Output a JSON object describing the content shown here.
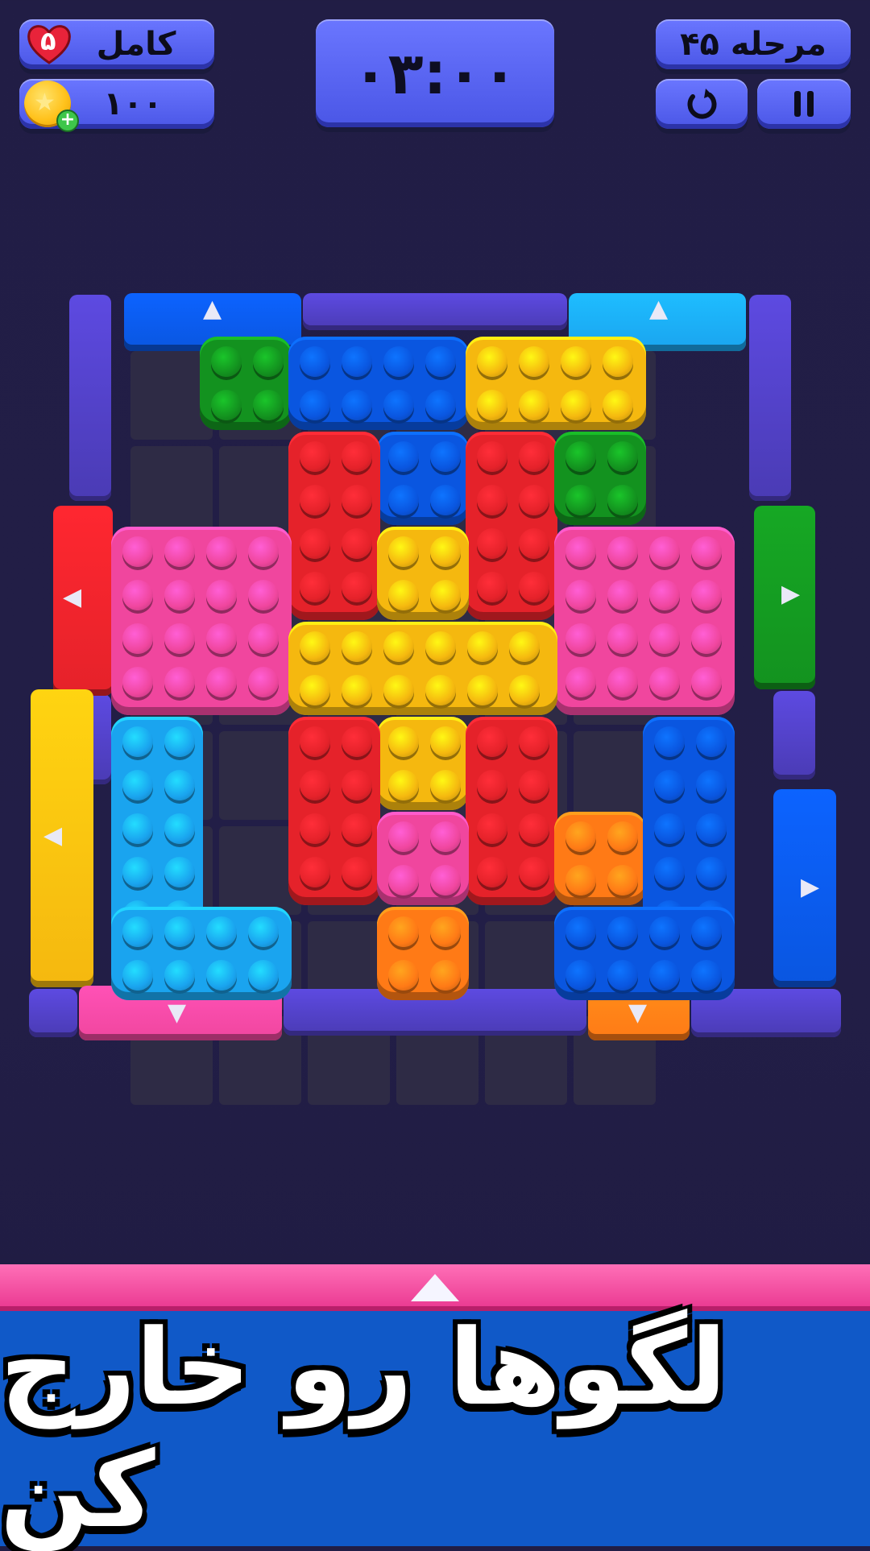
{
  "hud": {
    "lives_label": "کامل",
    "lives_count": "۵",
    "coins": "۱۰۰",
    "timer": "۰۳:۰۰",
    "level_label": "مرحله ۴۵",
    "restart_icon": "restart-icon",
    "pause_icon": "pause-icon",
    "heart_icon": "heart-icon",
    "coin_icon": "coin-icon"
  },
  "colors": {
    "red": "#e5222a",
    "yellow": "#f5b80f",
    "pink": "#f0469e",
    "blue": "#0a56e0",
    "skyblue": "#1aa4ef",
    "green": "#13921f",
    "orange": "#ff7a16",
    "wall": "#4a3bb4"
  },
  "banner": {
    "text": "لگوها رو خارج کن"
  }
}
